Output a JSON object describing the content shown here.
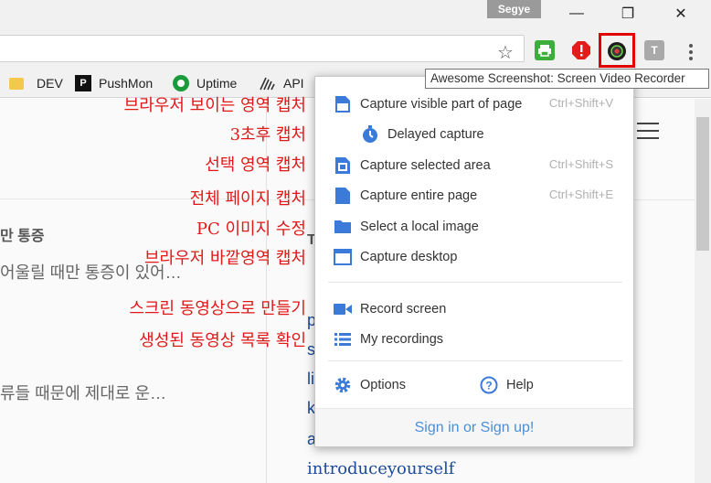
{
  "window": {
    "user_badge": "Segye",
    "minimize_glyph": "—",
    "restore_glyph": "❐",
    "close_glyph": "✕"
  },
  "toolbar": {
    "star_icon": "star-icon",
    "extensions": [
      {
        "name": "print-friendly-icon",
        "color": "#3cae3c"
      },
      {
        "name": "adblock-stop-icon",
        "color": "#e21b1b",
        "glyph": "!"
      },
      {
        "name": "awesome-screenshot-icon",
        "color": "#222222"
      },
      {
        "name": "t-extension-icon",
        "color": "#a9a9a9",
        "glyph": "T"
      }
    ]
  },
  "bookmarks": [
    {
      "label": "DEV",
      "icon": "folder-icon"
    },
    {
      "label": "PushMon",
      "icon": "p-icon",
      "glyph": "P"
    },
    {
      "label": "Uptime",
      "icon": "uptime-icon"
    },
    {
      "label": "API",
      "icon": "api-icon"
    }
  ],
  "tooltip": "Awesome Screenshot: Screen Video Recorder",
  "page": {
    "left_heading": "만 통증",
    "left_line1": "어울릴 때만 통증이 있어…",
    "left_line2": "류들 때문에 제대로 운…",
    "right_T": "T",
    "link_letters": [
      "p",
      "s",
      "li",
      "k",
      "a"
    ],
    "link_last": "introduceyourself"
  },
  "annotations": [
    "브라우저 보이는 영역 캡처",
    "3초후 캡처",
    "선택 영역 캡처",
    "전체 페이지 캡처",
    "PC 이미지 수정",
    "브라우저 바깥영역 캡처",
    "스크린 동영상으로 만들기",
    "생성된 동영상 목록 확인"
  ],
  "popup": {
    "items": [
      {
        "label": "Capture visible part of page",
        "shortcut": "Ctrl+Shift+V",
        "icon": "capture-visible-icon"
      },
      {
        "label": "Delayed capture",
        "shortcut": "",
        "icon": "timer-icon"
      },
      {
        "label": "Capture selected area",
        "shortcut": "Ctrl+Shift+S",
        "icon": "capture-selected-icon"
      },
      {
        "label": "Capture entire page",
        "shortcut": "Ctrl+Shift+E",
        "icon": "capture-entire-icon"
      },
      {
        "label": "Select a local image",
        "shortcut": "",
        "icon": "folder-icon"
      },
      {
        "label": "Capture desktop",
        "shortcut": "",
        "icon": "desktop-icon"
      }
    ],
    "record_screen": "Record screen",
    "my_recordings": "My recordings",
    "options": "Options",
    "help": "Help",
    "footer": "Sign in or Sign up!"
  },
  "colors": {
    "accent": "#3b7ad9",
    "annotation": "#e01818",
    "highlight": "#e00000"
  }
}
